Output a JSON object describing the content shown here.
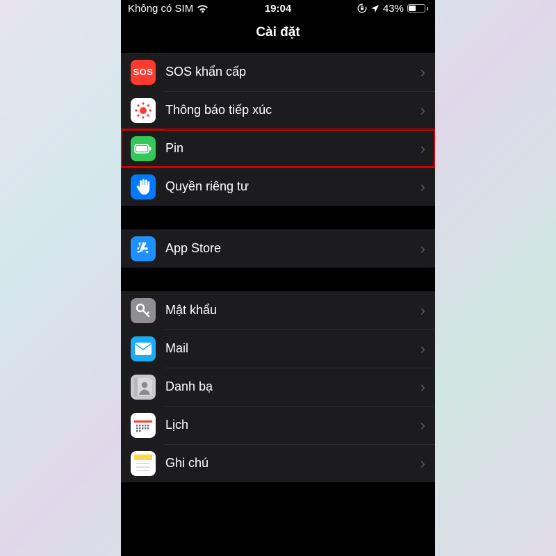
{
  "status": {
    "sim": "Không có SIM",
    "time": "19:04",
    "battery_pct": "43%"
  },
  "nav": {
    "title": "Cài đặt"
  },
  "groups": [
    {
      "rows": [
        {
          "id": "sos",
          "label": "SOS khẩn cấp"
        },
        {
          "id": "exposure",
          "label": "Thông báo tiếp xúc"
        },
        {
          "id": "battery",
          "label": "Pin",
          "highlight": true
        },
        {
          "id": "privacy",
          "label": "Quyền riêng tư"
        }
      ]
    },
    {
      "rows": [
        {
          "id": "appstore",
          "label": "App Store"
        }
      ]
    },
    {
      "rows": [
        {
          "id": "passwords",
          "label": "Mật khẩu"
        },
        {
          "id": "mail",
          "label": "Mail"
        },
        {
          "id": "contacts",
          "label": "Danh bạ"
        },
        {
          "id": "calendar",
          "label": "Lịch"
        },
        {
          "id": "notes",
          "label": "Ghi chú"
        }
      ]
    }
  ]
}
